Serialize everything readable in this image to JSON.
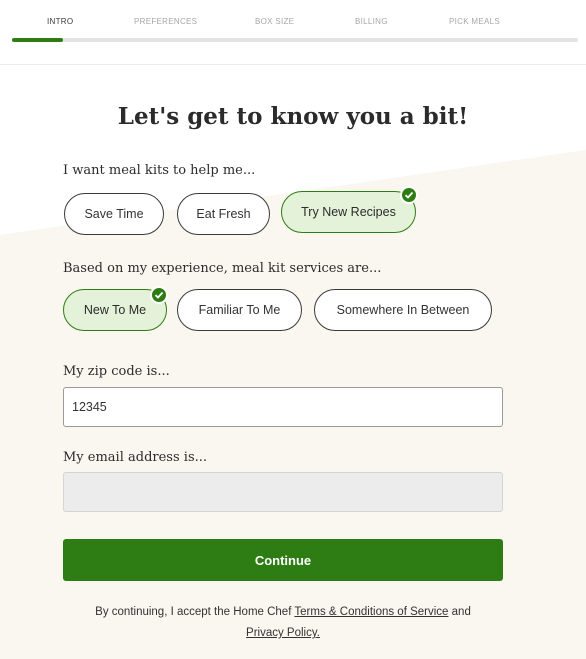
{
  "progress": {
    "steps": [
      "INTRO",
      "PREFERENCES",
      "BOX SIZE",
      "BILLING",
      "PICK MEALS"
    ],
    "completed_fraction": 0.09
  },
  "heading": "Let's get to know you a bit!",
  "q1": {
    "label": "I want meal kits to help me...",
    "options": [
      "Save Time",
      "Eat Fresh",
      "Try New Recipes"
    ],
    "selected": "Try New Recipes"
  },
  "q2": {
    "label": "Based on my experience, meal kit services are...",
    "options": [
      "New To Me",
      "Familiar To Me",
      "Somewhere In Between"
    ],
    "selected": "New To Me"
  },
  "zip": {
    "label": "My zip code is...",
    "value": "12345"
  },
  "email": {
    "label": "My email address is...",
    "value": ""
  },
  "continue_label": "Continue",
  "legal": {
    "prefix": "By continuing, I accept the Home Chef",
    "terms_link": "Terms & Conditions of Service",
    "and": "and",
    "privacy_link": "Privacy Policy."
  },
  "colors": {
    "accent": "#2e7d14",
    "selected_fill": "#e4f2d9",
    "cream_bg": "#faf6f0"
  }
}
